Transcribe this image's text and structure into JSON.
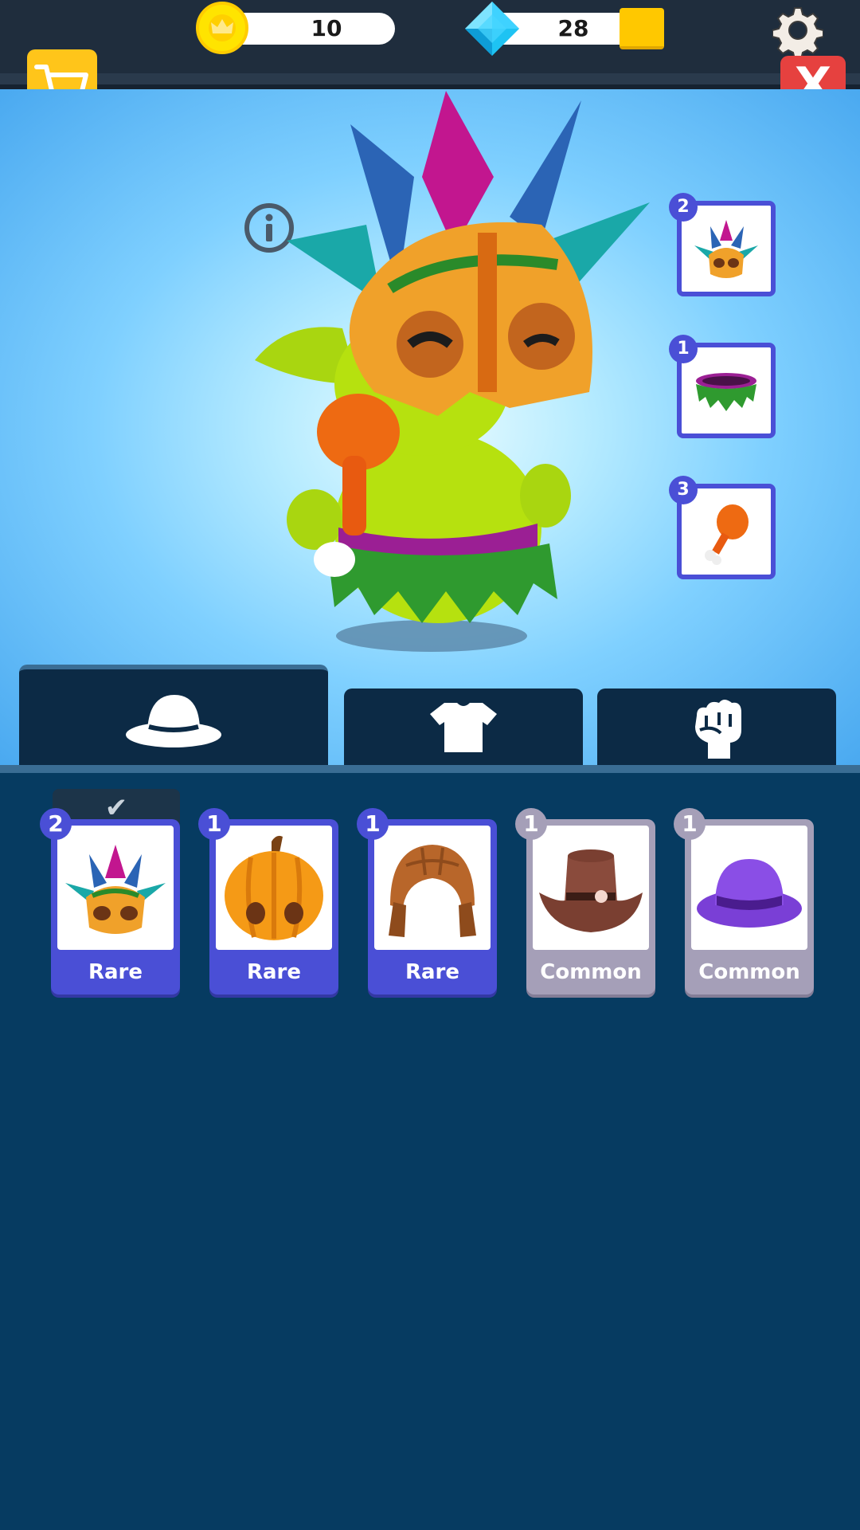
{
  "currency": {
    "coins": "10",
    "gems": "28"
  },
  "buttons": {
    "close_label": "X"
  },
  "equipped_slots": [
    {
      "count": "2",
      "item": "tribal-mask"
    },
    {
      "count": "1",
      "item": "grass-skirt"
    },
    {
      "count": "3",
      "item": "drumstick"
    }
  ],
  "tabs": [
    "hat",
    "shirt",
    "fist"
  ],
  "inventory": [
    {
      "count": "2",
      "rarity": "Rare",
      "item": "tribal-mask",
      "equipped": true
    },
    {
      "count": "1",
      "rarity": "Rare",
      "item": "pumpkin-helmet"
    },
    {
      "count": "1",
      "rarity": "Rare",
      "item": "leather-helmet"
    },
    {
      "count": "1",
      "rarity": "Common",
      "item": "cowboy-hat"
    },
    {
      "count": "1",
      "rarity": "Common",
      "item": "purple-bowler-hat"
    }
  ],
  "equipped_mark": "✔",
  "colors": {
    "rare": "#4a4fd6",
    "common": "#a59fb8",
    "panel": "#063b61",
    "topbar": "#1f2d3d"
  }
}
